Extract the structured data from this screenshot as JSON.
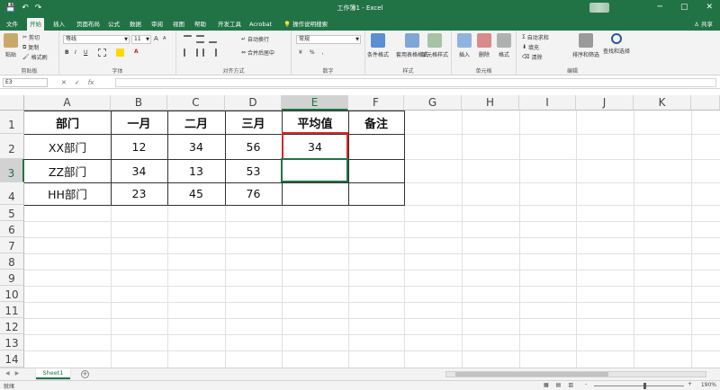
{
  "titlebar": {
    "title": "工作簿1 - Excel",
    "qat_undo": "↶",
    "qat_redo": "↷",
    "qat_save": "💾",
    "minimize": "─",
    "restore": "▢",
    "close": "✕"
  },
  "tabs": [
    "文件",
    "开始",
    "插入",
    "页面布局",
    "公式",
    "数据",
    "审阅",
    "视图",
    "帮助",
    "开发工具",
    "Acrobat",
    "操作说明搜索"
  ],
  "share": "共享",
  "ribbon": {
    "clipboard": {
      "paste": "粘贴",
      "cut": "剪切",
      "copy": "复制",
      "format_painter": "格式刷",
      "label": "剪贴板"
    },
    "font": {
      "name": "等线",
      "size": "11",
      "label": "字体",
      "bold": "B",
      "italic": "I",
      "underline": "U",
      "grow": "A",
      "shrink": "A",
      "color": "A"
    },
    "alignment": {
      "wrap": "自动换行",
      "merge": "合并后居中",
      "label": "对齐方式"
    },
    "number": {
      "format": "常规",
      "label": "数字",
      "percent": "%",
      "comma": ",",
      "currency": "¥"
    },
    "styles": {
      "conditional": "条件格式",
      "table": "套用表格格式",
      "cell": "单元格样式",
      "label": "样式"
    },
    "cells": {
      "insert": "插入",
      "delete": "删除",
      "format": "格式",
      "label": "单元格"
    },
    "editing": {
      "autosum": "自动求和",
      "fill": "填充",
      "clear": "清除",
      "sort": "排序和筛选",
      "find": "查找和选择",
      "label": "编辑"
    }
  },
  "formula_bar": {
    "name_box": "E3",
    "cancel": "✕",
    "enter": "✓",
    "fx": "fx",
    "formula": ""
  },
  "columns": [
    "A",
    "B",
    "C",
    "D",
    "E",
    "F",
    "G",
    "H",
    "I",
    "J",
    "K"
  ],
  "selected_column": "E",
  "rows": [
    "1",
    "2",
    "3",
    "4",
    "5",
    "6",
    "7",
    "8",
    "9",
    "10",
    "11",
    "12",
    "13",
    "14"
  ],
  "selected_row": "3",
  "table": {
    "headers": [
      "部门",
      "一月",
      "二月",
      "三月",
      "平均值",
      "备注"
    ],
    "data": [
      [
        "XX部门",
        "12",
        "34",
        "56",
        "34",
        ""
      ],
      [
        "ZZ部门",
        "34",
        "13",
        "53",
        "",
        ""
      ],
      [
        "HH部门",
        "23",
        "45",
        "76",
        "",
        ""
      ]
    ]
  },
  "highlighted_cell": "E2",
  "selected_cell": "E3",
  "sheet_tabs": [
    "Sheet1"
  ],
  "add_sheet": "+",
  "status": {
    "ready": "就绪",
    "zoom": "190%",
    "zoom_minus": "-",
    "zoom_plus": "+"
  },
  "colors": {
    "excel_green": "#217346",
    "highlight_red": "#d9262a"
  }
}
